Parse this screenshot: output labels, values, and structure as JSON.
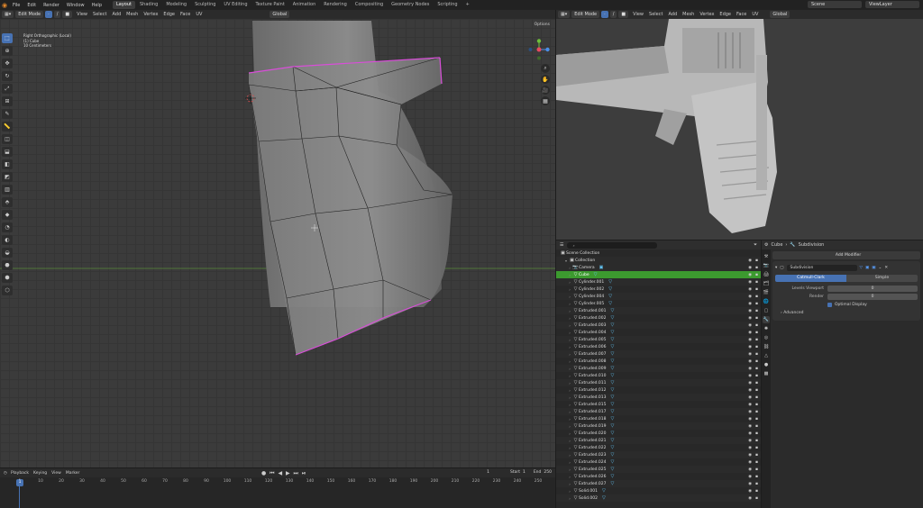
{
  "topbar": {
    "menus": [
      "File",
      "Edit",
      "Render",
      "Window",
      "Help"
    ],
    "workspaces": [
      "Layout",
      "Shading",
      "Modeling",
      "Sculpting",
      "UV Editing",
      "Texture Paint",
      "Animation",
      "Rendering",
      "Compositing",
      "Geometry Nodes",
      "Scripting"
    ],
    "active_workspace": "Layout",
    "add_tab": "+",
    "scene": "Scene",
    "view_layer": "ViewLayer"
  },
  "left_viewport": {
    "mode": "Edit Mode",
    "menus": [
      "View",
      "Select",
      "Add",
      "Mesh",
      "Vertex",
      "Edge",
      "Face",
      "UV"
    ],
    "transform": "Global",
    "info_line1": "Right Orthographic (Local)",
    "info_line2": "(1) Cube",
    "info_line3": "10 Centimeters",
    "options": "Options"
  },
  "right_viewport": {
    "mode": "Edit Mode",
    "menus": [
      "View",
      "Select",
      "Add",
      "Mesh",
      "Vertex",
      "Edge",
      "Face",
      "UV"
    ],
    "transform": "Global"
  },
  "outliner": {
    "scene_collection": "Scene Collection",
    "collection": "Collection",
    "items": [
      {
        "name": "Camera",
        "type": "camera"
      },
      {
        "name": "Cube",
        "type": "mesh",
        "selected": true
      },
      {
        "name": "Cylinder.001",
        "type": "mesh"
      },
      {
        "name": "Cylinder.002",
        "type": "mesh"
      },
      {
        "name": "Cylinder.004",
        "type": "mesh"
      },
      {
        "name": "Cylinder.005",
        "type": "mesh"
      },
      {
        "name": "Extruded.001",
        "type": "mesh"
      },
      {
        "name": "Extruded.002",
        "type": "mesh"
      },
      {
        "name": "Extruded.003",
        "type": "mesh"
      },
      {
        "name": "Extruded.004",
        "type": "mesh"
      },
      {
        "name": "Extruded.005",
        "type": "mesh"
      },
      {
        "name": "Extruded.006",
        "type": "mesh"
      },
      {
        "name": "Extruded.007",
        "type": "mesh"
      },
      {
        "name": "Extruded.008",
        "type": "mesh"
      },
      {
        "name": "Extruded.009",
        "type": "mesh"
      },
      {
        "name": "Extruded.010",
        "type": "mesh"
      },
      {
        "name": "Extruded.011",
        "type": "mesh"
      },
      {
        "name": "Extruded.012",
        "type": "mesh"
      },
      {
        "name": "Extruded.013",
        "type": "mesh"
      },
      {
        "name": "Extruded.015",
        "type": "mesh"
      },
      {
        "name": "Extruded.017",
        "type": "mesh"
      },
      {
        "name": "Extruded.018",
        "type": "mesh"
      },
      {
        "name": "Extruded.019",
        "type": "mesh"
      },
      {
        "name": "Extruded.020",
        "type": "mesh"
      },
      {
        "name": "Extruded.021",
        "type": "mesh"
      },
      {
        "name": "Extruded.022",
        "type": "mesh"
      },
      {
        "name": "Extruded.023",
        "type": "mesh"
      },
      {
        "name": "Extruded.024",
        "type": "mesh"
      },
      {
        "name": "Extruded.025",
        "type": "mesh"
      },
      {
        "name": "Extruded.026",
        "type": "mesh"
      },
      {
        "name": "Extruded.027",
        "type": "mesh"
      },
      {
        "name": "Solid.001",
        "type": "mesh"
      },
      {
        "name": "Solid.002",
        "type": "mesh"
      }
    ]
  },
  "properties": {
    "object": "Cube",
    "modifier_tab": "Subdivision",
    "add_modifier": "Add Modifier",
    "modifier_name": "Subdivision",
    "catmull": "Catmull-Clark",
    "simple": "Simple",
    "levels_viewport_label": "Levels Viewport",
    "levels_viewport": "0",
    "render_label": "Render",
    "render": "0",
    "optimal_display": "Optimal Display",
    "advanced": "Advanced"
  },
  "timeline": {
    "menus": [
      "Playback",
      "Keying",
      "View",
      "Marker"
    ],
    "current_frame": "1",
    "start_label": "Start",
    "start": "1",
    "end_label": "End",
    "end": "250",
    "ticks": [
      "1",
      "10",
      "20",
      "30",
      "40",
      "50",
      "60",
      "70",
      "80",
      "90",
      "100",
      "110",
      "120",
      "130",
      "140",
      "150",
      "160",
      "170",
      "180",
      "190",
      "200",
      "210",
      "220",
      "230",
      "240",
      "250"
    ]
  },
  "colors": {
    "accent": "#4772b3",
    "selected_row": "#3c9a2f",
    "edge_select": "#d94ed9",
    "x_axis": "#e84a5f",
    "y_axis": "#6fbf3a",
    "z_axis": "#4a8fe8"
  }
}
